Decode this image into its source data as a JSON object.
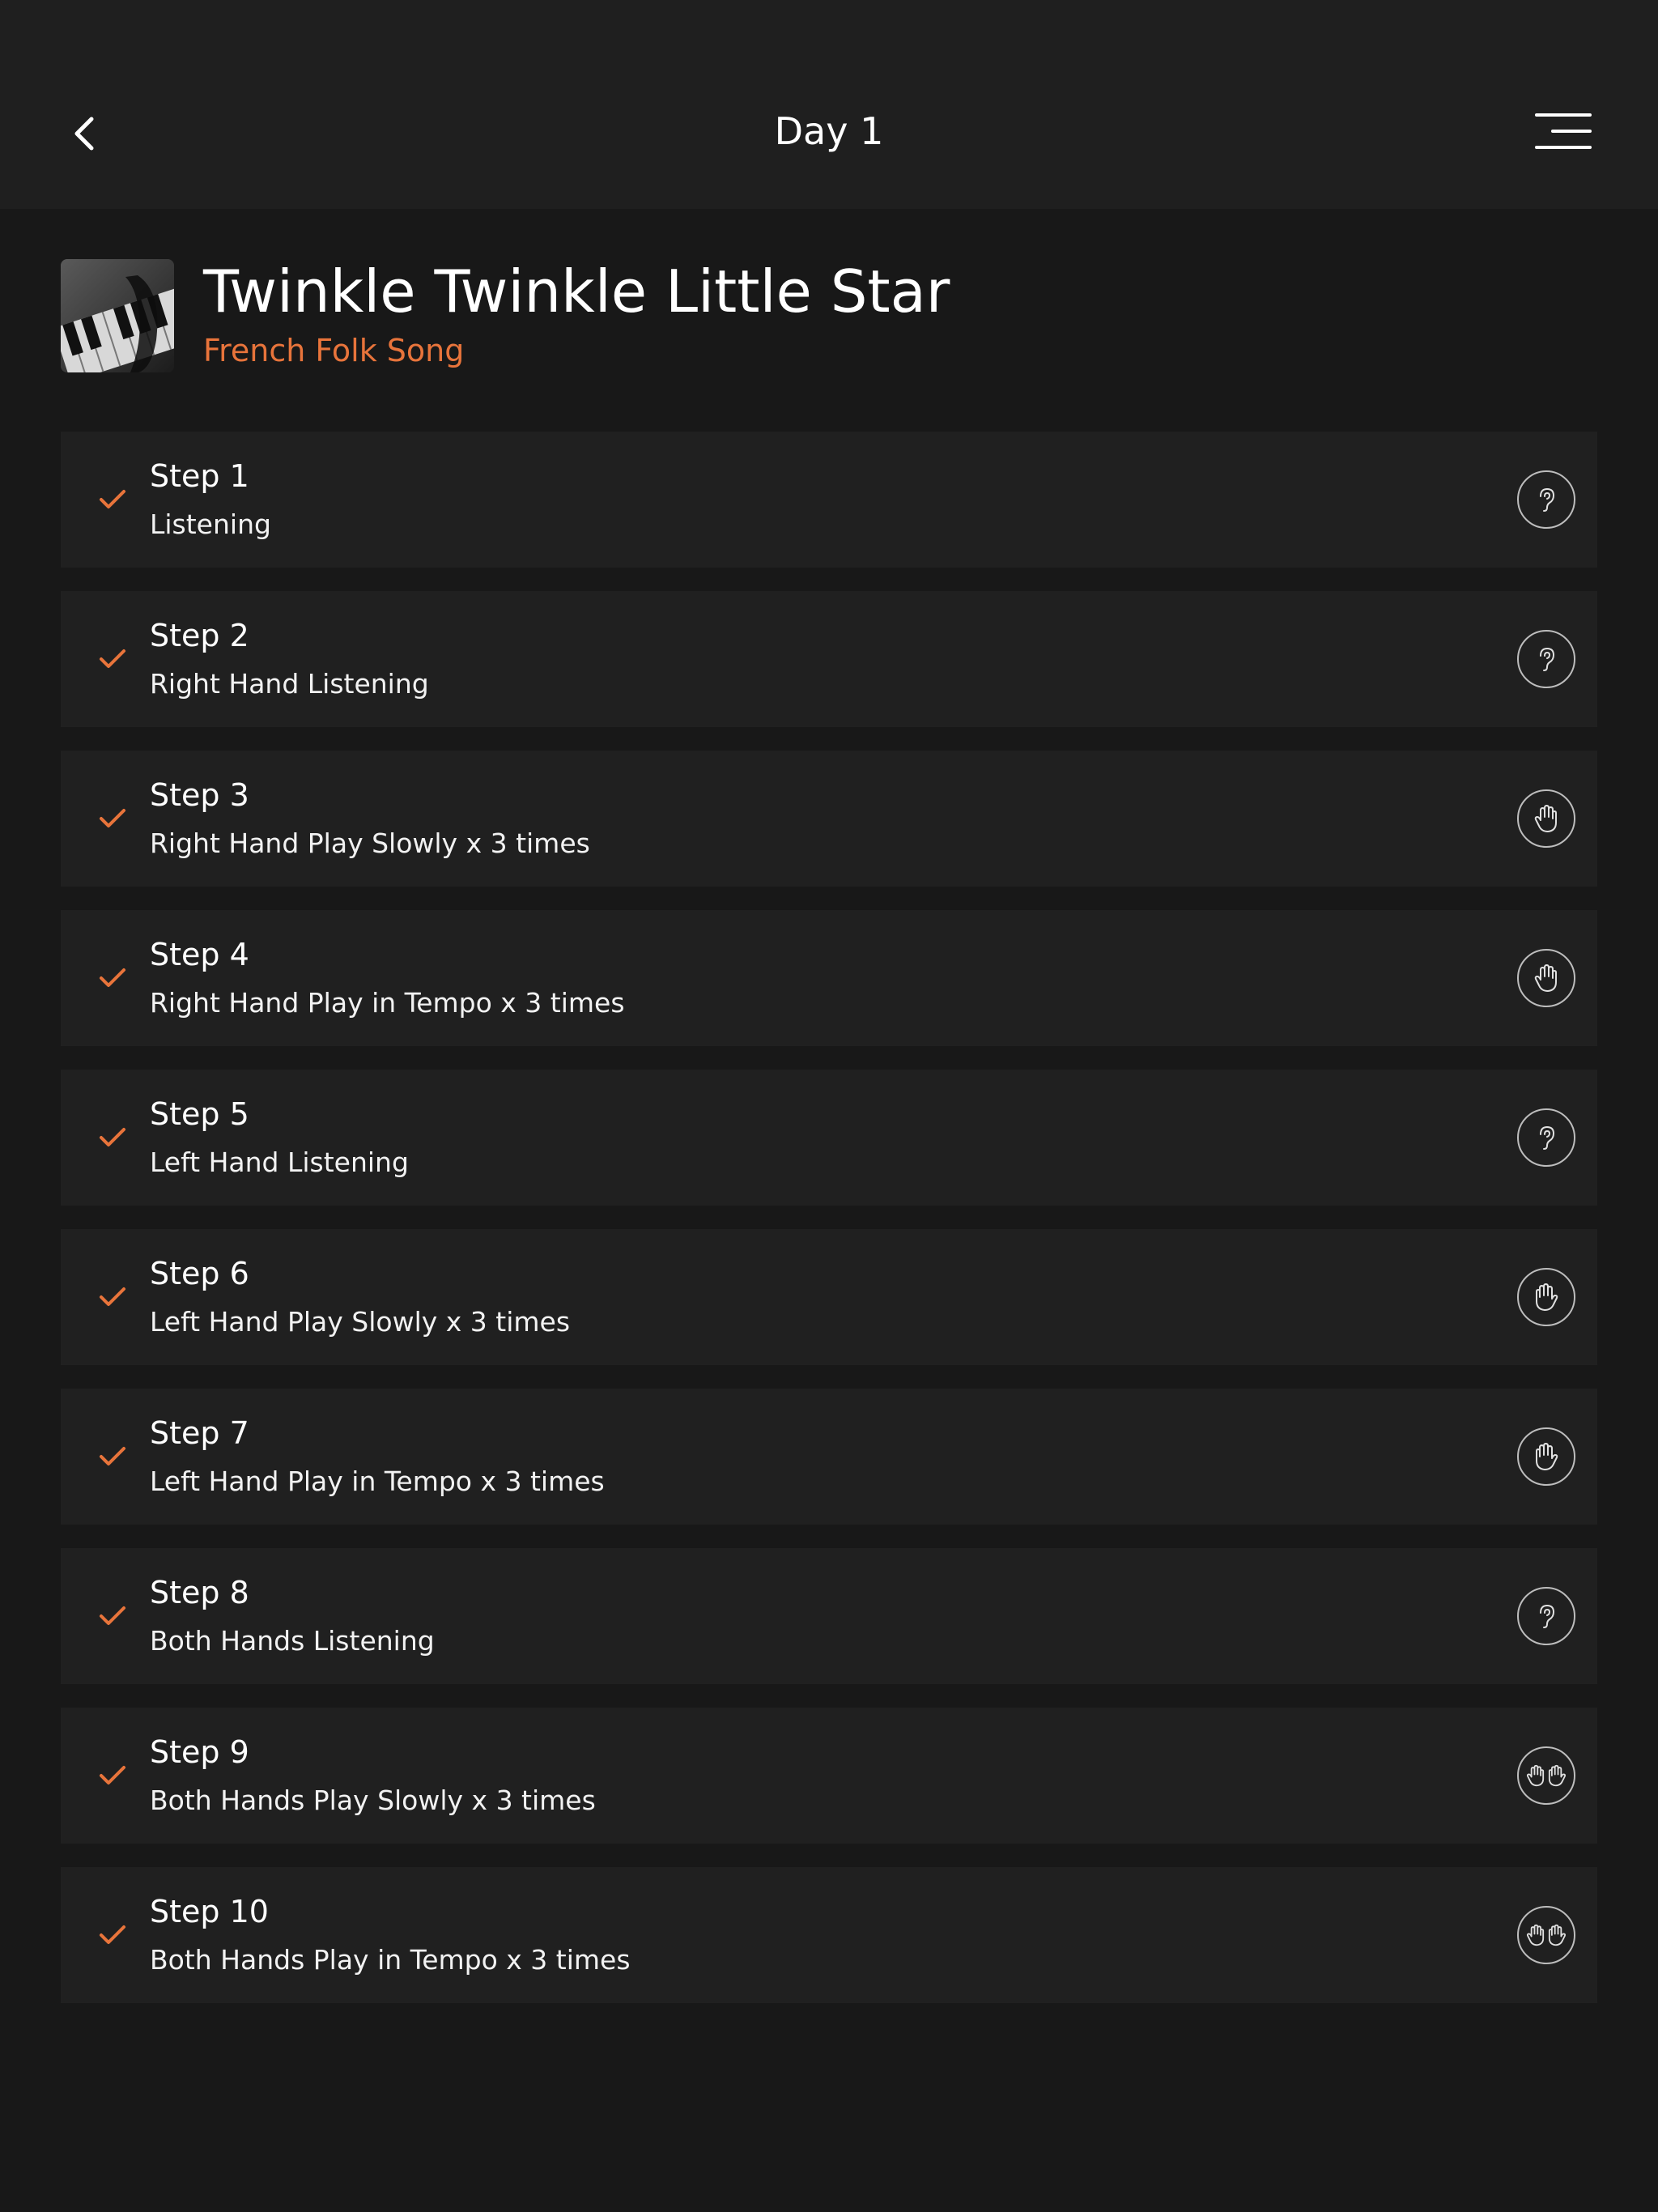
{
  "header": {
    "title": "Day 1",
    "back_icon": "chevron-left-icon",
    "menu_icon": "hamburger-menu-icon"
  },
  "song": {
    "title": "Twinkle Twinkle Little Star",
    "subtitle": "French Folk Song",
    "thumbnail": "piano-keys-image"
  },
  "colors": {
    "accent": "#e8743b",
    "background": "#181818",
    "card": "#202020",
    "header": "#1f1f1f"
  },
  "steps": [
    {
      "title": "Step 1",
      "description": "Listening",
      "icon": "ear-icon",
      "completed": true
    },
    {
      "title": "Step 2",
      "description": "Right Hand Listening",
      "icon": "ear-icon",
      "completed": true
    },
    {
      "title": "Step 3",
      "description": "Right Hand Play Slowly x 3 times",
      "icon": "right-hand-icon",
      "completed": true
    },
    {
      "title": "Step 4",
      "description": "Right Hand Play in Tempo x 3 times",
      "icon": "right-hand-icon",
      "completed": true
    },
    {
      "title": "Step 5",
      "description": "Left Hand Listening",
      "icon": "ear-icon",
      "completed": true
    },
    {
      "title": "Step 6",
      "description": "Left Hand Play Slowly x 3 times",
      "icon": "left-hand-icon",
      "completed": true
    },
    {
      "title": "Step 7",
      "description": "Left Hand Play in Tempo x 3 times",
      "icon": "left-hand-icon",
      "completed": true
    },
    {
      "title": "Step 8",
      "description": "Both Hands Listening",
      "icon": "ear-icon",
      "completed": true
    },
    {
      "title": "Step 9",
      "description": "Both Hands Play Slowly x 3 times",
      "icon": "both-hands-icon",
      "completed": true
    },
    {
      "title": "Step 10",
      "description": "Both Hands Play in Tempo x 3 times",
      "icon": "both-hands-icon",
      "completed": true
    }
  ]
}
